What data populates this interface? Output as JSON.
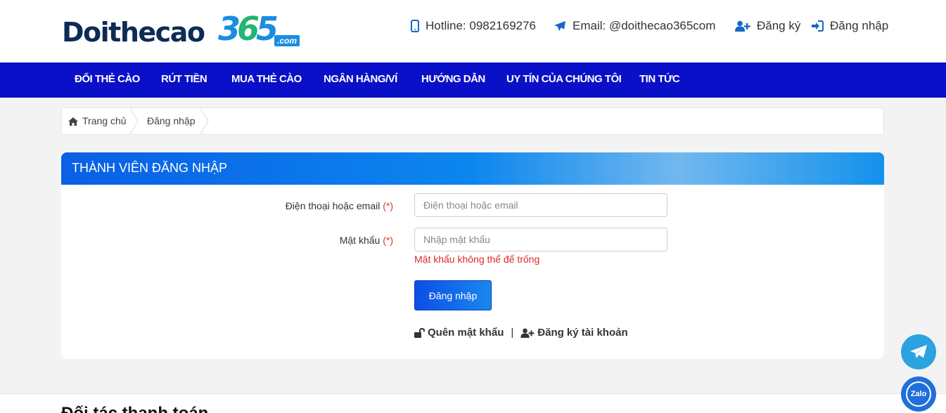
{
  "header": {
    "logo": {
      "main": "Doithecao",
      "num": [
        "3",
        "6",
        "5"
      ],
      "tld": ".com"
    },
    "hotline": "Hotline: 0982169276",
    "email": "Email: @doithecao365com",
    "register": "Đăng ký",
    "login": "Đăng nhập"
  },
  "nav": {
    "items": [
      "ĐỔI THẺ CÀO",
      "RÚT TIỀN",
      "MUA THẺ CÀO",
      "NGÂN HÀNG/VÍ",
      "HƯỚNG DẪN",
      "UY TÍN CỦA CHÚNG TÔI",
      "TIN TỨC"
    ]
  },
  "breadcrumb": {
    "home": "Trang chủ",
    "current": "Đăng nhập"
  },
  "form": {
    "title": "THÀNH VIÊN ĐĂNG NHẬP",
    "phone_label": "Điện thoại hoặc email",
    "required_mark": "(*)",
    "phone_placeholder": "Điện thoại hoặc email",
    "password_label": "Mật khẩu",
    "password_placeholder": "Nhập mật khẩu",
    "password_error": "Mật khẩu không thể để trống",
    "submit": "Đăng nhập",
    "forgot": "Quên mật khẩu",
    "separator": "|",
    "register": "Đăng ký tài khoản"
  },
  "footer": {
    "partners_title": "Đối tác thanh toán"
  },
  "floating": {
    "zalo": "Zalo"
  },
  "colors": {
    "nav_bg": "#0a10c8",
    "accent": "#1667c7",
    "error": "#d92b2b"
  }
}
